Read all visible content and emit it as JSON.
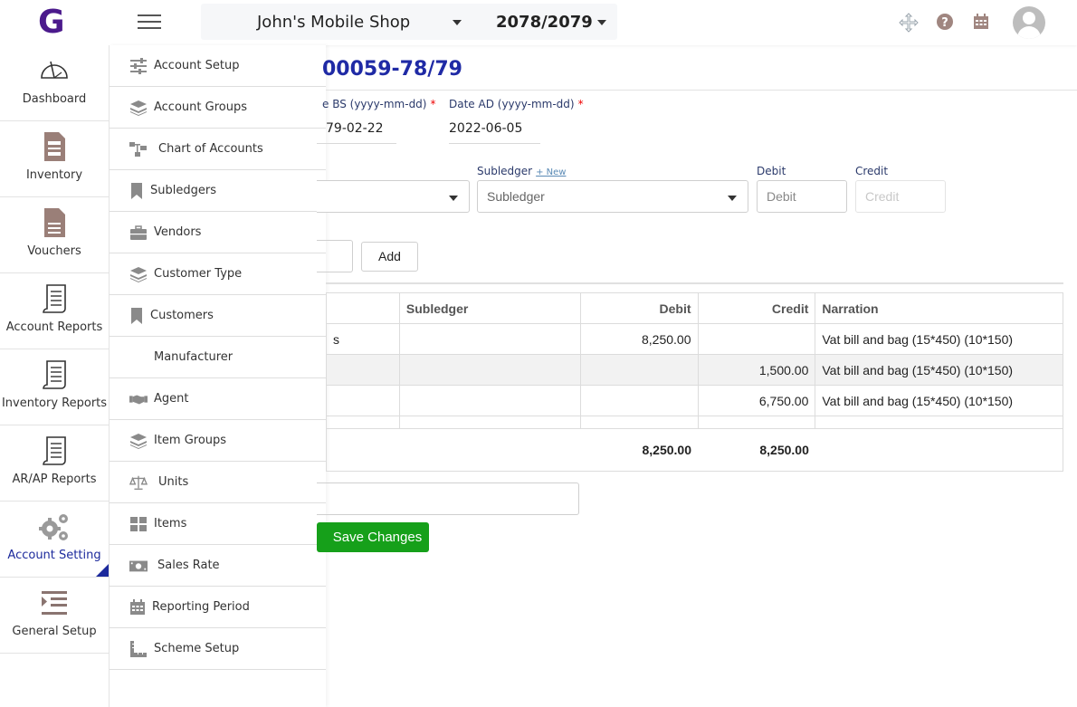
{
  "app": {
    "logo": "G"
  },
  "header": {
    "shop_name": "John's Mobile Shop",
    "fiscal_year": "2078/2079",
    "icons": [
      "move-icon",
      "help-icon",
      "calendar-icon"
    ]
  },
  "sidebar": {
    "items": [
      {
        "label": "Dashboard",
        "icon": "dashboard-gauge-icon"
      },
      {
        "label": "Inventory",
        "icon": "inventory-doc-icon"
      },
      {
        "label": "Vouchers",
        "icon": "voucher-doc-icon"
      },
      {
        "label": "Account Reports",
        "icon": "scroll-icon"
      },
      {
        "label": "Inventory Reports",
        "icon": "scroll-icon"
      },
      {
        "label": "AR/AP Reports",
        "icon": "scroll-icon"
      },
      {
        "label": "Account Setting",
        "icon": "gears-icon",
        "active": true
      },
      {
        "label": "General Setup",
        "icon": "indent-list-icon"
      }
    ]
  },
  "submenu": {
    "items": [
      {
        "label": "Account Setup",
        "icon": "sliders-icon"
      },
      {
        "label": "Account Groups",
        "icon": "layers-icon"
      },
      {
        "label": "Chart of Accounts",
        "icon": "sitemap-icon"
      },
      {
        "label": "Subledgers",
        "icon": "bookmark-icon"
      },
      {
        "label": "Vendors",
        "icon": "briefcase-icon"
      },
      {
        "label": "Customer Type",
        "icon": "layers-icon"
      },
      {
        "label": "Customers",
        "icon": "bookmark-icon"
      },
      {
        "label": "Manufacturer",
        "icon": ""
      },
      {
        "label": "Agent",
        "icon": "handshake-icon"
      },
      {
        "label": "Item Groups",
        "icon": "layers-icon"
      },
      {
        "label": "Units",
        "icon": "balance-scale-icon"
      },
      {
        "label": "Items",
        "icon": "grid-icon"
      },
      {
        "label": "Sales Rate",
        "icon": "money-bill-icon"
      },
      {
        "label": "Reporting Period",
        "icon": "calendar-icon"
      },
      {
        "label": "Scheme Setup",
        "icon": "ruler-icon"
      }
    ]
  },
  "voucher": {
    "title": "00059-78/79",
    "date_bs_label": "e BS (yyyy-mm-dd)",
    "date_bs_value": "79-02-22",
    "date_ad_label": "Date AD (yyyy-mm-dd)",
    "date_ad_value": "2022-06-05",
    "subledger_label": "Subledger",
    "subledger_new": "+ New",
    "subledger_placeholder": "Subledger",
    "debit_label": "Debit",
    "debit_placeholder": "Debit",
    "credit_label": "Credit",
    "credit_placeholder": "Credit",
    "add_button": "Add",
    "save_button": "Save Changes",
    "required_mark": "*"
  },
  "table": {
    "columns": [
      "",
      "Subledger",
      "Debit",
      "Credit",
      "Narration"
    ],
    "rows": [
      {
        "account": "s",
        "subledger": "",
        "debit": "8,250.00",
        "credit": "",
        "narration": "Vat bill and bag (15*450) (10*150)"
      },
      {
        "account": "",
        "subledger": "",
        "debit": "",
        "credit": "1,500.00",
        "narration": "Vat bill and bag (15*450) (10*150)"
      },
      {
        "account": "",
        "subledger": "",
        "debit": "",
        "credit": "6,750.00",
        "narration": "Vat bill and bag (15*450) (10*150)"
      }
    ],
    "total_debit": "8,250.00",
    "total_credit": "8,250.00"
  }
}
